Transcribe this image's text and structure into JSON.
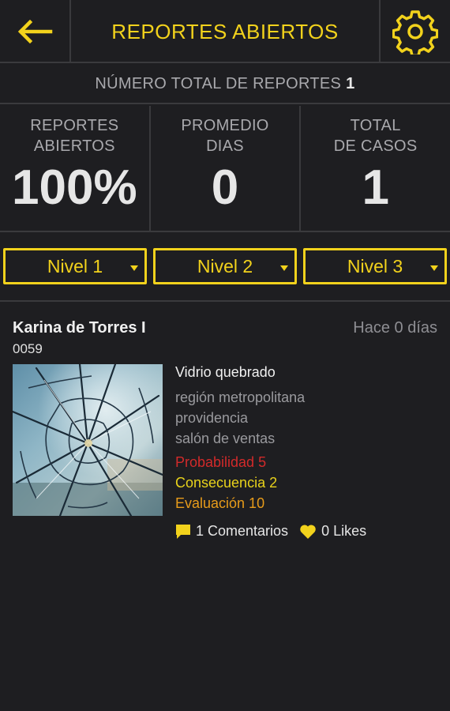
{
  "header": {
    "title": "REPORTES ABIERTOS",
    "back_icon": "arrow-left-icon",
    "settings_icon": "gear-icon",
    "accent": "#f2d21c"
  },
  "total": {
    "label": "NÚMERO TOTAL DE REPORTES",
    "count": "1"
  },
  "stats": [
    {
      "label": "REPORTES\nABIERTOS",
      "value": "100%"
    },
    {
      "label": "PROMEDIO\nDIAS",
      "value": "0"
    },
    {
      "label": "TOTAL\nDE CASOS",
      "value": "1"
    }
  ],
  "filters": [
    {
      "label": "Nivel 1"
    },
    {
      "label": "Nivel 2"
    },
    {
      "label": "Nivel 3"
    }
  ],
  "report": {
    "author": "Karina de Torres I",
    "time_ago": "Hace 0 días",
    "id": "0059",
    "title": "Vidrio quebrado",
    "region": "región metropolitana",
    "commune": "providencia",
    "place": "salón de ventas",
    "probability": "Probabilidad 5",
    "consequence": "Consecuencia 2",
    "evaluation": "Evaluación 10",
    "comments": "1 Comentarios",
    "likes": "0 Likes",
    "colors": {
      "probability": "#d22a2a",
      "consequence": "#e8d21b",
      "evaluation": "#e79b1a"
    }
  }
}
